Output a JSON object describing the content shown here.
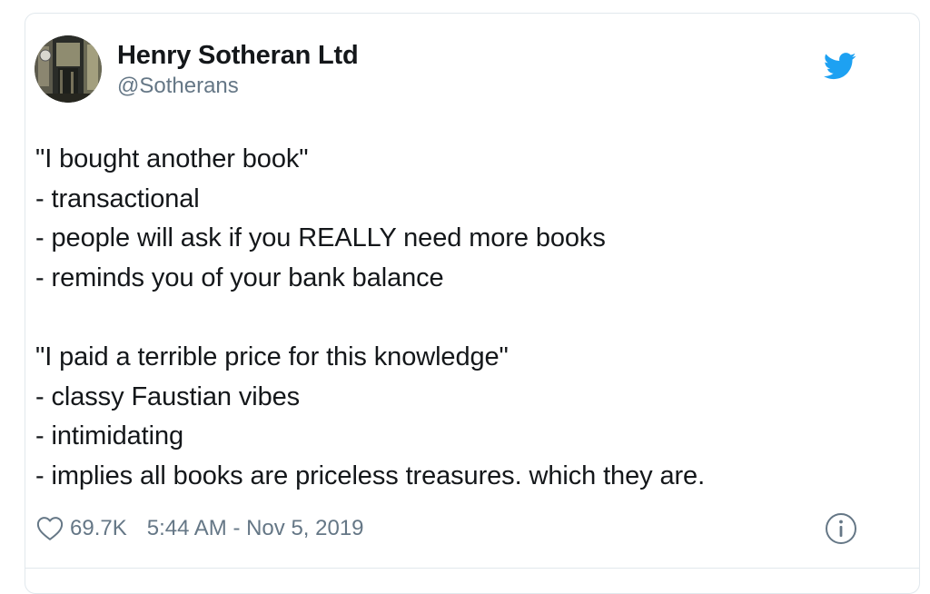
{
  "author": {
    "display_name": "Henry Sotheran Ltd",
    "handle": "@Sotherans"
  },
  "tweet": {
    "lines": [
      "\"I bought another book\"",
      "- transactional",
      "- people will ask if you REALLY need more books",
      "- reminds you of your bank balance",
      "",
      "\"I paid a terrible price for this knowledge\"",
      "- classy Faustian vibes",
      "- intimidating",
      "- implies all books are priceless treasures. which they are."
    ]
  },
  "footer": {
    "likes": "69.7K",
    "timestamp": "5:44 AM - Nov 5, 2019"
  },
  "icons": {
    "brand": "twitter-bird-icon",
    "like": "heart-icon",
    "info": "info-icon"
  },
  "colors": {
    "brand_blue": "#1da1f2",
    "text_primary": "#14171a",
    "text_secondary": "#657786",
    "border": "#e1e8ed"
  }
}
